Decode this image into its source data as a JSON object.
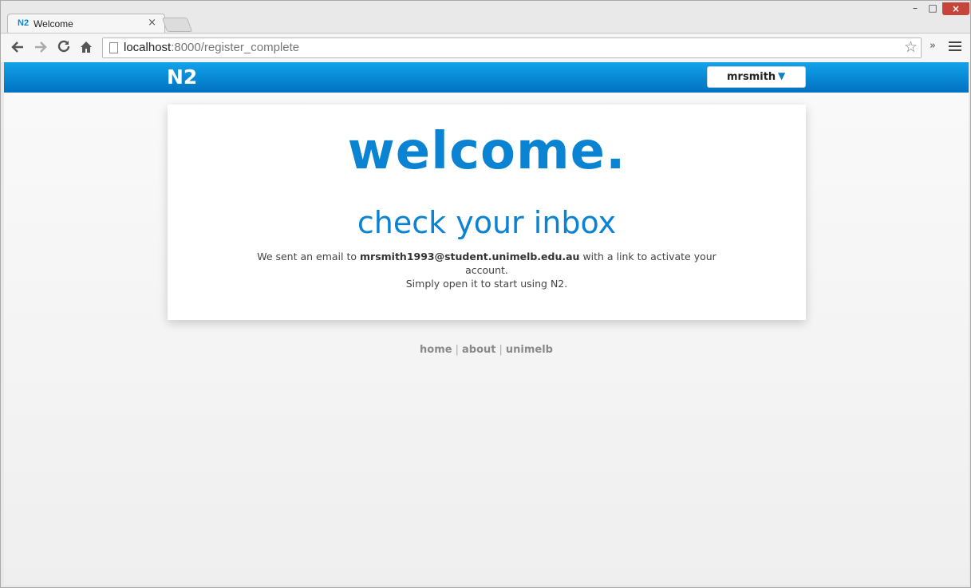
{
  "browser": {
    "tab_favicon": "N2",
    "tab_title": "Welcome",
    "tab_close": "×",
    "win_minimize": "–",
    "win_maximize": "□",
    "win_close": "×",
    "url_host": "localhost",
    "url_rest": ":8000/register_complete",
    "extensions_label": "»"
  },
  "header": {
    "brand": "N2",
    "username": "mrsmith",
    "caret": "▼"
  },
  "main": {
    "welcome": "welcome.",
    "subhead": "check your inbox",
    "msg_before": "We sent an email to ",
    "email": "mrsmith1993@student.unimelb.edu.au",
    "msg_after": " with a link to activate your account.",
    "msg_line2": "Simply open it to start using N2."
  },
  "footer": {
    "links": [
      "home",
      "about",
      "unimelb"
    ],
    "separator": "|"
  },
  "colors": {
    "accent": "#0a84d2",
    "navbar_top": "#12a3ea",
    "navbar_bottom": "#0071c0"
  }
}
